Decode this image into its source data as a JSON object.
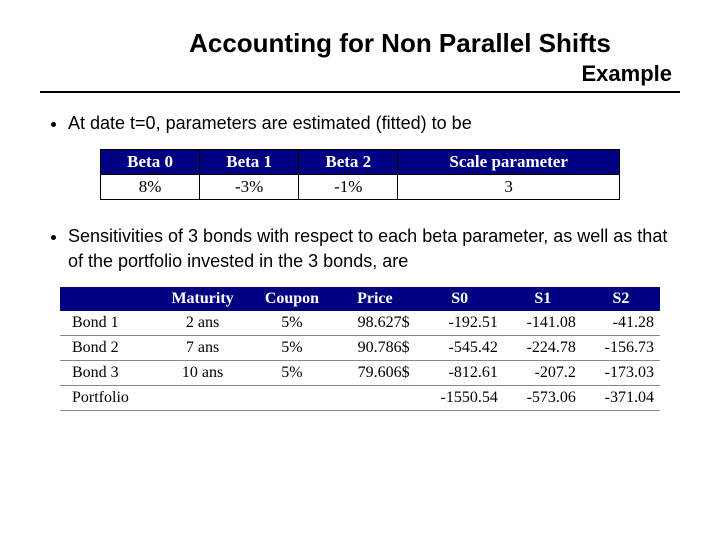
{
  "title": "Accounting for Non Parallel Shifts",
  "subtitle": "Example",
  "bullet1": "At date t=0, parameters are estimated (fitted) to be",
  "bullet2": "Sensitivities of 3 bonds with respect to each beta parameter, as well as that of the portfolio invested in the 3 bonds, are",
  "beta_table": {
    "headers": [
      "Beta 0",
      "Beta 1",
      "Beta 2",
      "Scale parameter"
    ],
    "row": [
      "8%",
      "-3%",
      "-1%",
      "3"
    ]
  },
  "sens_table": {
    "headers": [
      "",
      "Maturity",
      "Coupon",
      "Price",
      "S0",
      "S1",
      "S2"
    ],
    "rows": [
      {
        "label": "Bond 1",
        "maturity": "2 ans",
        "coupon": "5%",
        "price": "98.627$",
        "s0": "-192.51",
        "s1": "-141.08",
        "s2": "-41.28"
      },
      {
        "label": "Bond 2",
        "maturity": "7 ans",
        "coupon": "5%",
        "price": "90.786$",
        "s0": "-545.42",
        "s1": "-224.78",
        "s2": "-156.73"
      },
      {
        "label": "Bond 3",
        "maturity": "10 ans",
        "coupon": "5%",
        "price": "79.606$",
        "s0": "-812.61",
        "s1": "-207.2",
        "s2": "-173.03"
      },
      {
        "label": "Portfolio",
        "maturity": "",
        "coupon": "",
        "price": "",
        "s0": "-1550.54",
        "s1": "-573.06",
        "s2": "-371.04"
      }
    ]
  },
  "chart_data": {
    "type": "table",
    "title": "Accounting for Non Parallel Shifts — Example",
    "parameters_at_t0": {
      "Beta 0": "8%",
      "Beta 1": "-3%",
      "Beta 2": "-1%",
      "Scale parameter": 3
    },
    "sensitivities": [
      {
        "name": "Bond 1",
        "maturity_years": 2,
        "coupon": 0.05,
        "price": 98.627,
        "S0": -192.51,
        "S1": -141.08,
        "S2": -41.28
      },
      {
        "name": "Bond 2",
        "maturity_years": 7,
        "coupon": 0.05,
        "price": 90.786,
        "S0": -545.42,
        "S1": -224.78,
        "S2": -156.73
      },
      {
        "name": "Bond 3",
        "maturity_years": 10,
        "coupon": 0.05,
        "price": 79.606,
        "S0": -812.61,
        "S1": -207.2,
        "S2": -173.03
      },
      {
        "name": "Portfolio",
        "S0": -1550.54,
        "S1": -573.06,
        "S2": -371.04
      }
    ]
  }
}
